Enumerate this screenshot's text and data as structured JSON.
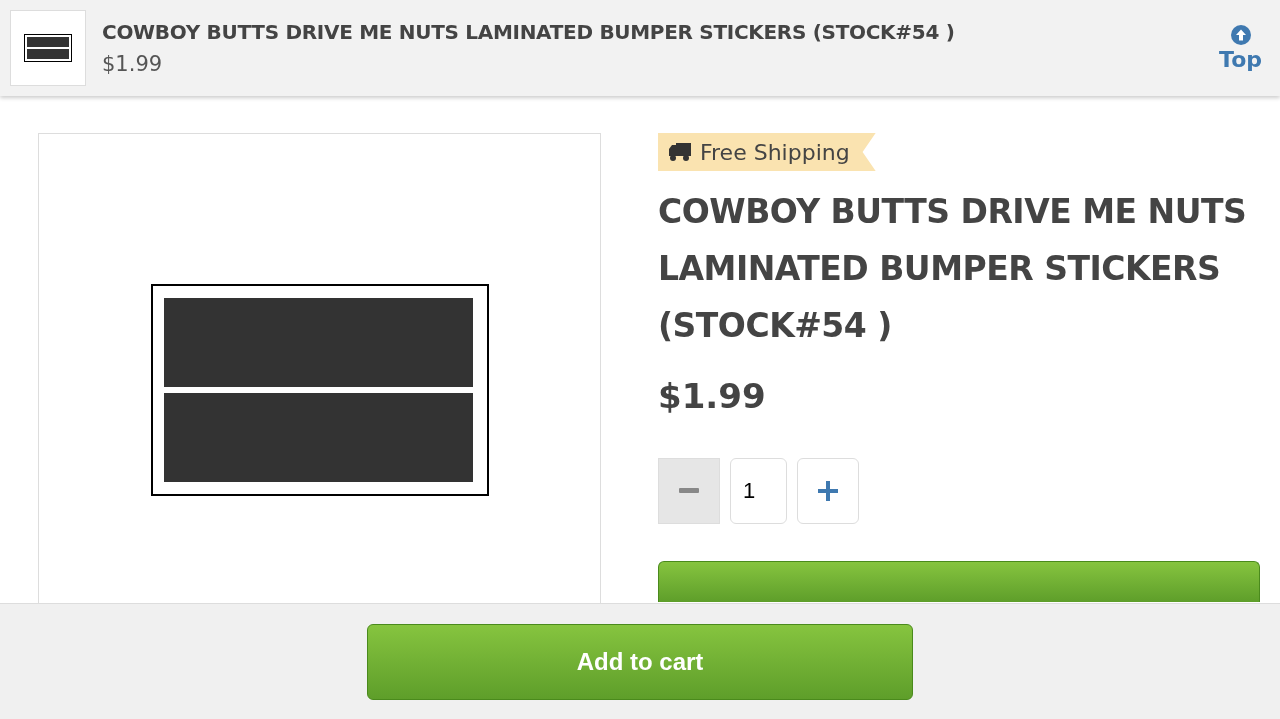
{
  "header": {
    "title": "COWBOY BUTTS DRIVE ME NUTS LAMINATED BUMPER STICKERS (STOCK#54 )",
    "price": "$1.99",
    "top_link": "Top"
  },
  "product": {
    "badge": "Free Shipping",
    "title": "COWBOY BUTTS DRIVE ME NUTS LAMINATED BUMPER STICKERS (STOCK#54 )",
    "price": "$1.99",
    "quantity": {
      "value": "1",
      "decrease_disabled": true
    }
  },
  "bottom_bar": {
    "button": "Add to cart"
  }
}
